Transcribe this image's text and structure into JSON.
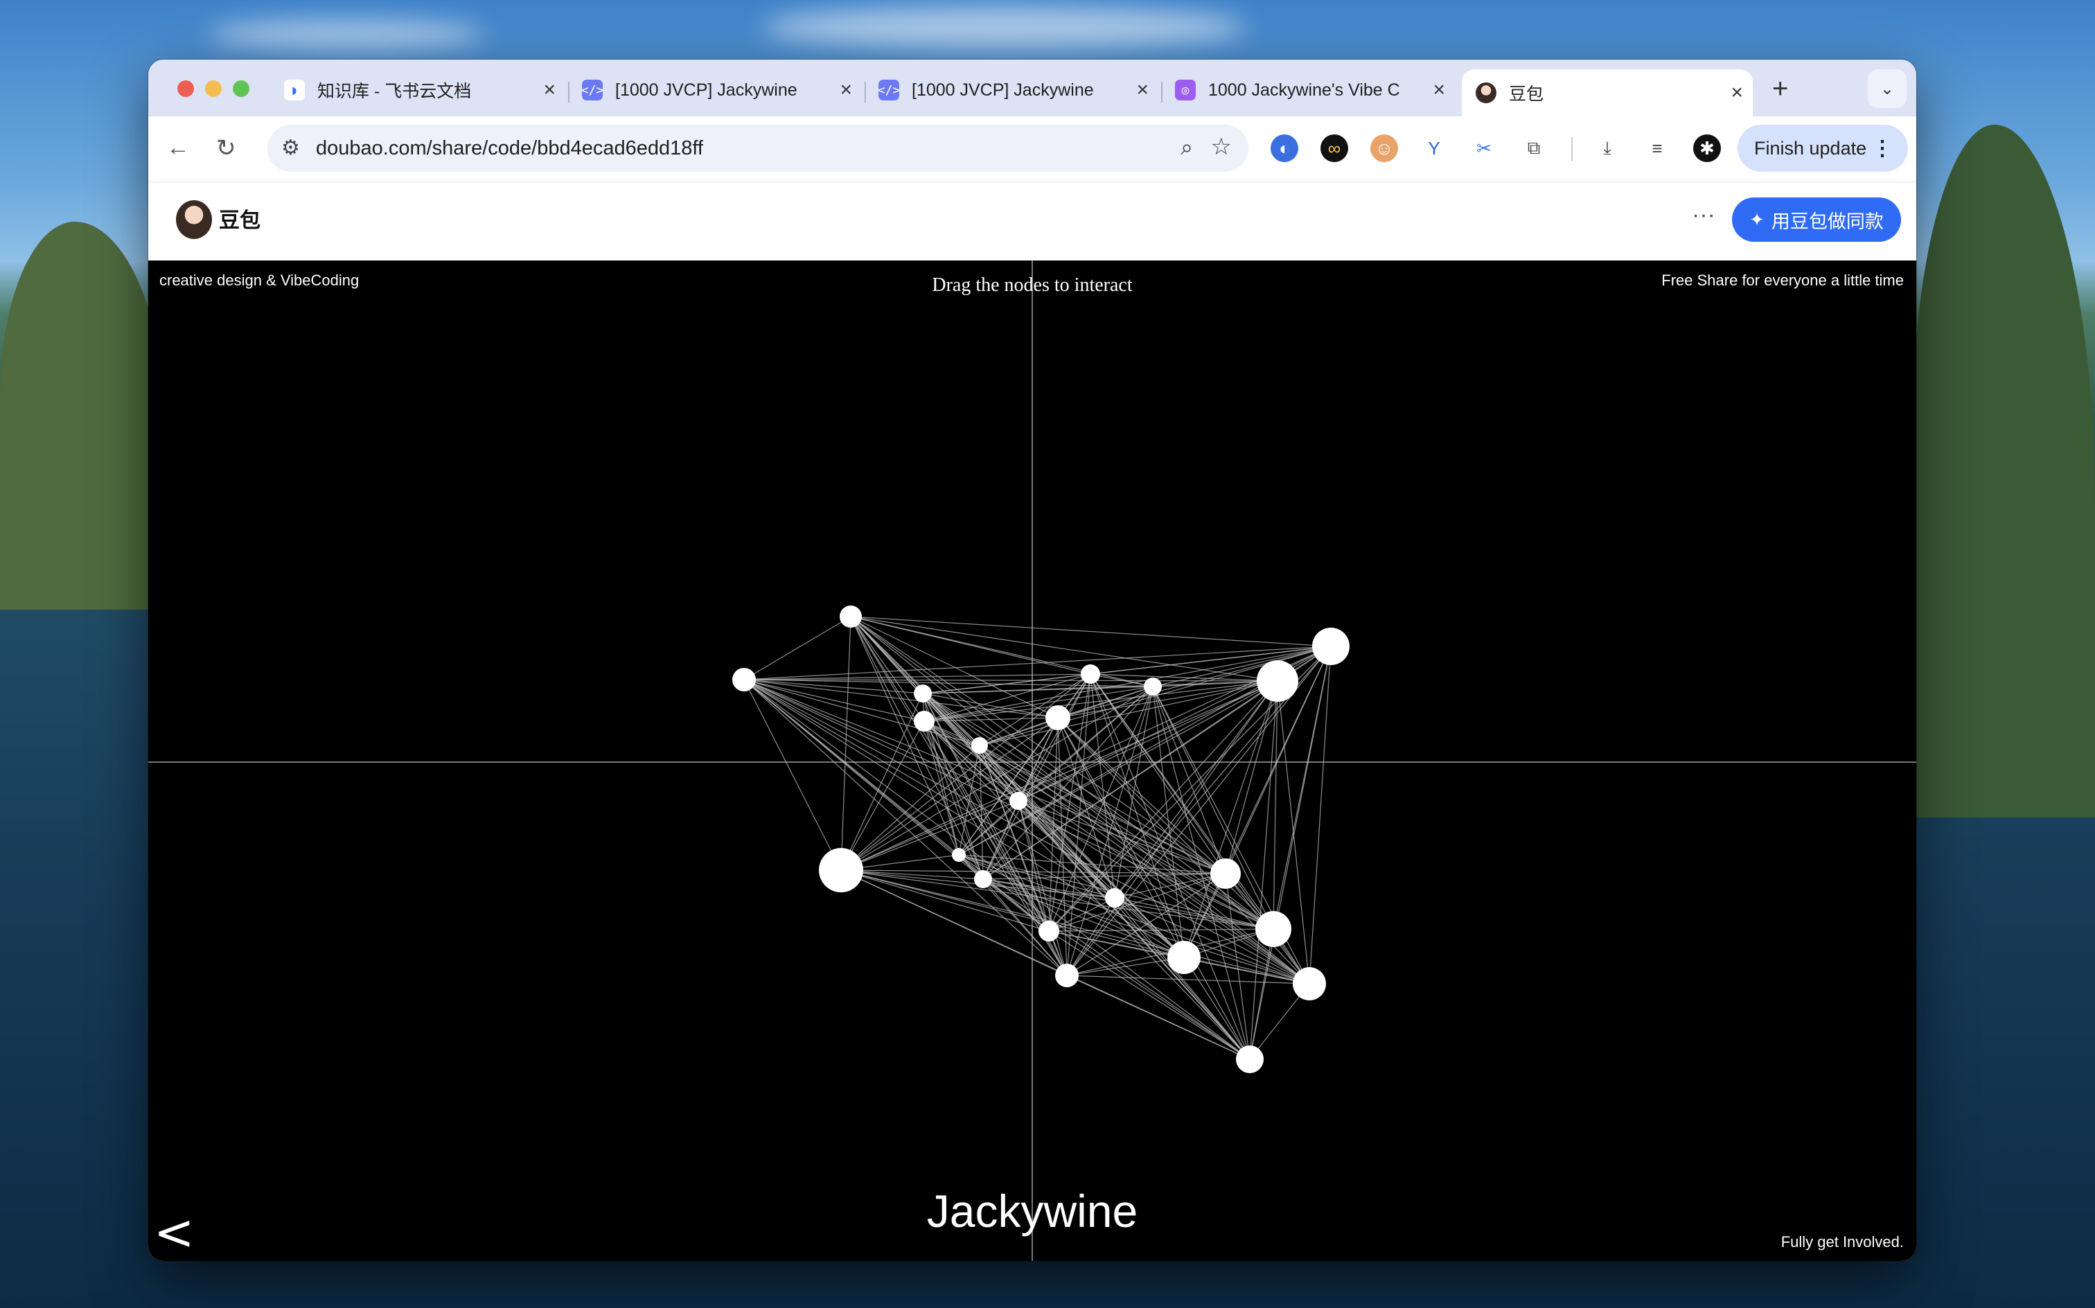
{
  "browser": {
    "tabs": [
      {
        "title": "知识库 - 飞书云文档",
        "icon": "feishu-icon",
        "active": false
      },
      {
        "title": "[1000 JVCP] Jackywine",
        "icon": "code-icon",
        "active": false
      },
      {
        "title": "[1000 JVCP] Jackywine",
        "icon": "code-icon",
        "active": false
      },
      {
        "title": "1000 Jackywine's Vibe C",
        "icon": "vibe-icon",
        "active": false
      },
      {
        "title": "豆包",
        "icon": "doubao-avatar-icon",
        "active": true
      }
    ],
    "new_tab_label": "+",
    "url": "doubao.com/share/code/bbd4ecad6edd18ff",
    "update_button_label": "Finish update"
  },
  "app": {
    "name": "豆包",
    "more_label": "···",
    "cta_label": "用豆包做同款",
    "accent_color": "#2f6bf5"
  },
  "canvas": {
    "top_left_text": "creative design & VibeCoding",
    "top_center_text": "Drag the nodes to interact",
    "top_right_text": "Free Share for everyone a little time",
    "bottom_right_text": "Fully get Involved.",
    "title_text": "Jackywine",
    "back_label": "<"
  },
  "graph": {
    "node_count": 22,
    "edges": "fully connected"
  }
}
